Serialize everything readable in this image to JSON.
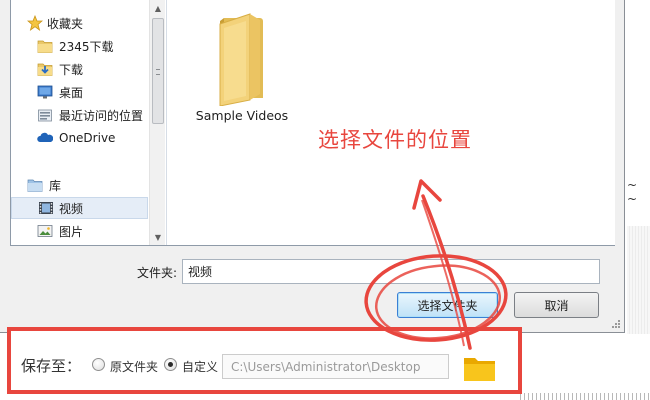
{
  "nav": {
    "favorites": "收藏夹",
    "items": [
      {
        "label": "2345下载",
        "icon": "folder-icon"
      },
      {
        "label": "下载",
        "icon": "download-folder-icon"
      },
      {
        "label": "桌面",
        "icon": "desktop-icon"
      },
      {
        "label": "最近访问的位置",
        "icon": "recent-places-icon"
      },
      {
        "label": "OneDrive",
        "icon": "onedrive-icon"
      }
    ],
    "libraries": "库",
    "library_items": [
      {
        "label": "视频",
        "icon": "video-library-icon",
        "selected": true
      },
      {
        "label": "图片",
        "icon": "picture-library-icon"
      }
    ]
  },
  "content": {
    "items": [
      {
        "name": "Sample Videos",
        "icon": "folder-icon"
      }
    ]
  },
  "annotation": {
    "text": "选择文件的位置",
    "color": "#e8463e"
  },
  "dialog": {
    "folder_label": "文件夹:",
    "folder_value": "视频",
    "select_button": "选择文件夹",
    "cancel_button": "取消"
  },
  "side_hint": "~ ~",
  "save_panel": {
    "label": "保存至：",
    "option_original": "原文件夹",
    "option_custom": "自定义",
    "selected_option": "自定义",
    "path": "C:\\Users\\Administrator\\Desktop",
    "highlight_color": "#e8463e"
  }
}
